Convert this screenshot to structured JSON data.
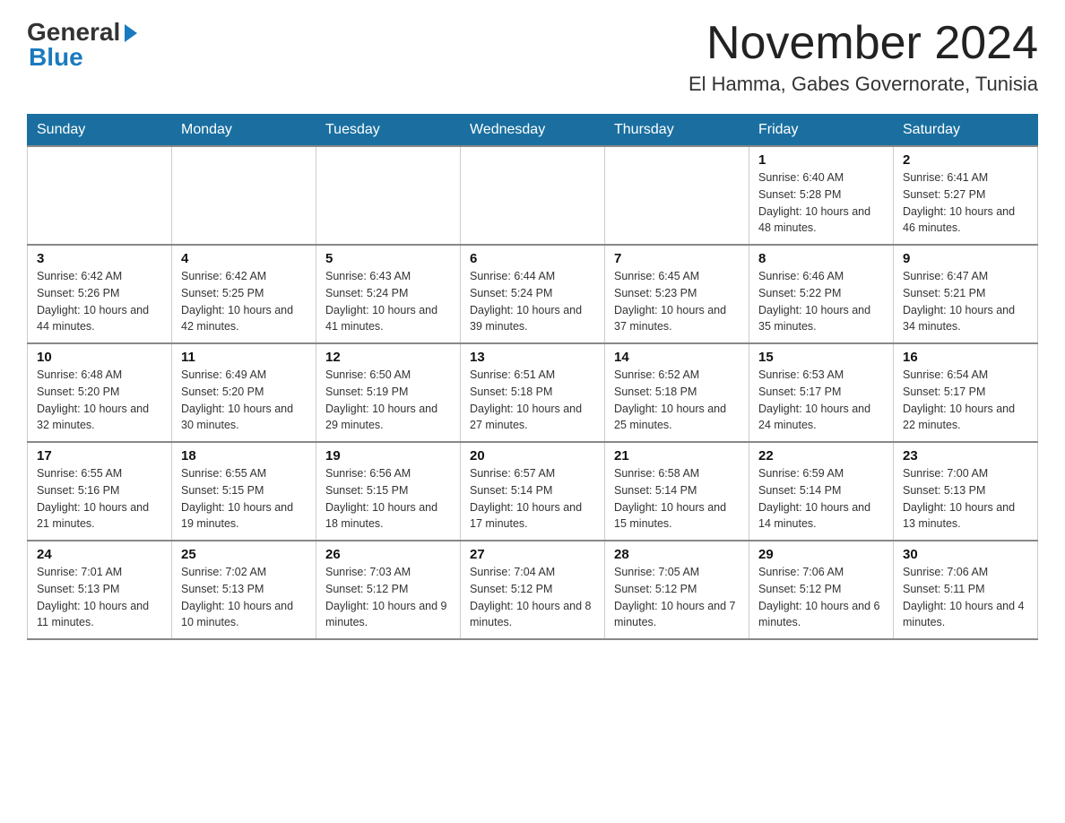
{
  "logo": {
    "general": "General",
    "blue": "Blue",
    "arrow": "▶"
  },
  "title": "November 2024",
  "location": "El Hamma, Gabes Governorate, Tunisia",
  "days_of_week": [
    "Sunday",
    "Monday",
    "Tuesday",
    "Wednesday",
    "Thursday",
    "Friday",
    "Saturday"
  ],
  "weeks": [
    [
      {
        "day": "",
        "info": ""
      },
      {
        "day": "",
        "info": ""
      },
      {
        "day": "",
        "info": ""
      },
      {
        "day": "",
        "info": ""
      },
      {
        "day": "",
        "info": ""
      },
      {
        "day": "1",
        "info": "Sunrise: 6:40 AM\nSunset: 5:28 PM\nDaylight: 10 hours and 48 minutes."
      },
      {
        "day": "2",
        "info": "Sunrise: 6:41 AM\nSunset: 5:27 PM\nDaylight: 10 hours and 46 minutes."
      }
    ],
    [
      {
        "day": "3",
        "info": "Sunrise: 6:42 AM\nSunset: 5:26 PM\nDaylight: 10 hours and 44 minutes."
      },
      {
        "day": "4",
        "info": "Sunrise: 6:42 AM\nSunset: 5:25 PM\nDaylight: 10 hours and 42 minutes."
      },
      {
        "day": "5",
        "info": "Sunrise: 6:43 AM\nSunset: 5:24 PM\nDaylight: 10 hours and 41 minutes."
      },
      {
        "day": "6",
        "info": "Sunrise: 6:44 AM\nSunset: 5:24 PM\nDaylight: 10 hours and 39 minutes."
      },
      {
        "day": "7",
        "info": "Sunrise: 6:45 AM\nSunset: 5:23 PM\nDaylight: 10 hours and 37 minutes."
      },
      {
        "day": "8",
        "info": "Sunrise: 6:46 AM\nSunset: 5:22 PM\nDaylight: 10 hours and 35 minutes."
      },
      {
        "day": "9",
        "info": "Sunrise: 6:47 AM\nSunset: 5:21 PM\nDaylight: 10 hours and 34 minutes."
      }
    ],
    [
      {
        "day": "10",
        "info": "Sunrise: 6:48 AM\nSunset: 5:20 PM\nDaylight: 10 hours and 32 minutes."
      },
      {
        "day": "11",
        "info": "Sunrise: 6:49 AM\nSunset: 5:20 PM\nDaylight: 10 hours and 30 minutes."
      },
      {
        "day": "12",
        "info": "Sunrise: 6:50 AM\nSunset: 5:19 PM\nDaylight: 10 hours and 29 minutes."
      },
      {
        "day": "13",
        "info": "Sunrise: 6:51 AM\nSunset: 5:18 PM\nDaylight: 10 hours and 27 minutes."
      },
      {
        "day": "14",
        "info": "Sunrise: 6:52 AM\nSunset: 5:18 PM\nDaylight: 10 hours and 25 minutes."
      },
      {
        "day": "15",
        "info": "Sunrise: 6:53 AM\nSunset: 5:17 PM\nDaylight: 10 hours and 24 minutes."
      },
      {
        "day": "16",
        "info": "Sunrise: 6:54 AM\nSunset: 5:17 PM\nDaylight: 10 hours and 22 minutes."
      }
    ],
    [
      {
        "day": "17",
        "info": "Sunrise: 6:55 AM\nSunset: 5:16 PM\nDaylight: 10 hours and 21 minutes."
      },
      {
        "day": "18",
        "info": "Sunrise: 6:55 AM\nSunset: 5:15 PM\nDaylight: 10 hours and 19 minutes."
      },
      {
        "day": "19",
        "info": "Sunrise: 6:56 AM\nSunset: 5:15 PM\nDaylight: 10 hours and 18 minutes."
      },
      {
        "day": "20",
        "info": "Sunrise: 6:57 AM\nSunset: 5:14 PM\nDaylight: 10 hours and 17 minutes."
      },
      {
        "day": "21",
        "info": "Sunrise: 6:58 AM\nSunset: 5:14 PM\nDaylight: 10 hours and 15 minutes."
      },
      {
        "day": "22",
        "info": "Sunrise: 6:59 AM\nSunset: 5:14 PM\nDaylight: 10 hours and 14 minutes."
      },
      {
        "day": "23",
        "info": "Sunrise: 7:00 AM\nSunset: 5:13 PM\nDaylight: 10 hours and 13 minutes."
      }
    ],
    [
      {
        "day": "24",
        "info": "Sunrise: 7:01 AM\nSunset: 5:13 PM\nDaylight: 10 hours and 11 minutes."
      },
      {
        "day": "25",
        "info": "Sunrise: 7:02 AM\nSunset: 5:13 PM\nDaylight: 10 hours and 10 minutes."
      },
      {
        "day": "26",
        "info": "Sunrise: 7:03 AM\nSunset: 5:12 PM\nDaylight: 10 hours and 9 minutes."
      },
      {
        "day": "27",
        "info": "Sunrise: 7:04 AM\nSunset: 5:12 PM\nDaylight: 10 hours and 8 minutes."
      },
      {
        "day": "28",
        "info": "Sunrise: 7:05 AM\nSunset: 5:12 PM\nDaylight: 10 hours and 7 minutes."
      },
      {
        "day": "29",
        "info": "Sunrise: 7:06 AM\nSunset: 5:12 PM\nDaylight: 10 hours and 6 minutes."
      },
      {
        "day": "30",
        "info": "Sunrise: 7:06 AM\nSunset: 5:11 PM\nDaylight: 10 hours and 4 minutes."
      }
    ]
  ]
}
